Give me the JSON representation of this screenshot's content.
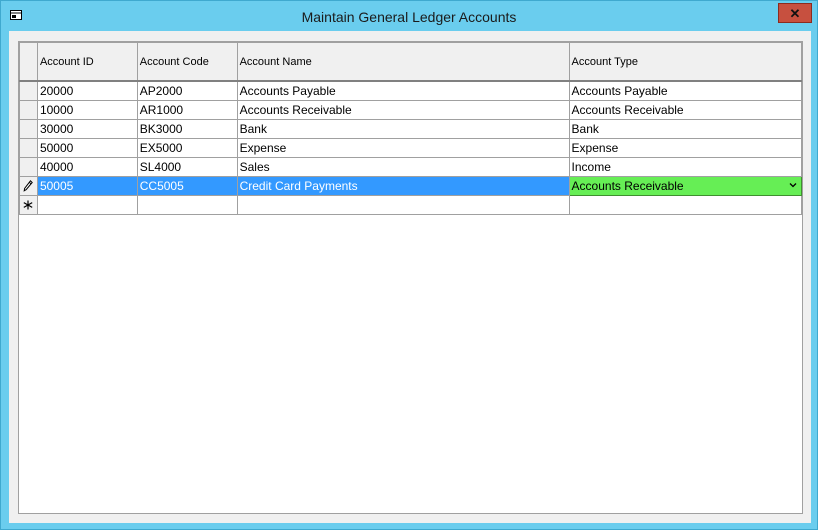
{
  "window": {
    "title": "Maintain General Ledger Accounts"
  },
  "grid": {
    "columns": [
      "Account ID",
      "Account Code",
      "Account Name",
      "Account Type"
    ],
    "rows": [
      {
        "id": "20000",
        "code": "AP2000",
        "name": "Accounts Payable",
        "type": "Accounts Payable"
      },
      {
        "id": "10000",
        "code": "AR1000",
        "name": "Accounts Receivable",
        "type": "Accounts Receivable"
      },
      {
        "id": "30000",
        "code": "BK3000",
        "name": "Bank",
        "type": "Bank"
      },
      {
        "id": "50000",
        "code": "EX5000",
        "name": "Expense",
        "type": "Expense"
      },
      {
        "id": "40000",
        "code": "SL4000",
        "name": "Sales",
        "type": "Income"
      },
      {
        "id": "50005",
        "code": "CC5005",
        "name": "Credit Card Payments",
        "type": "Accounts Receivable"
      }
    ],
    "selected_row_index": 5,
    "colors": {
      "selection": "#3399ff",
      "combo_editor": "#66ee55",
      "titlebar": "#6acdee",
      "close_button": "#c7503f"
    }
  }
}
